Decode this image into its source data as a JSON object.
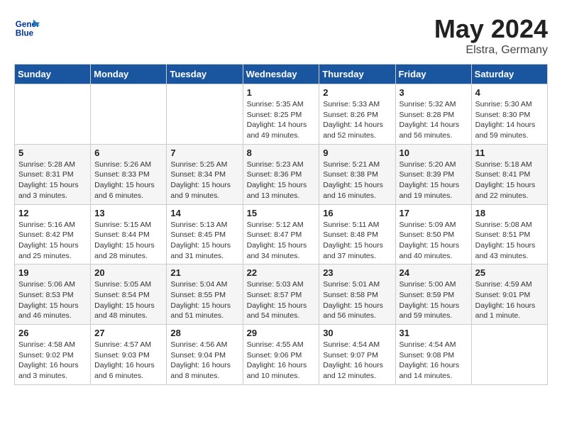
{
  "header": {
    "logo_line1": "General",
    "logo_line2": "Blue",
    "month": "May 2024",
    "location": "Elstra, Germany"
  },
  "weekdays": [
    "Sunday",
    "Monday",
    "Tuesday",
    "Wednesday",
    "Thursday",
    "Friday",
    "Saturday"
  ],
  "weeks": [
    [
      {
        "day": "",
        "info": ""
      },
      {
        "day": "",
        "info": ""
      },
      {
        "day": "",
        "info": ""
      },
      {
        "day": "1",
        "info": "Sunrise: 5:35 AM\nSunset: 8:25 PM\nDaylight: 14 hours\nand 49 minutes."
      },
      {
        "day": "2",
        "info": "Sunrise: 5:33 AM\nSunset: 8:26 PM\nDaylight: 14 hours\nand 52 minutes."
      },
      {
        "day": "3",
        "info": "Sunrise: 5:32 AM\nSunset: 8:28 PM\nDaylight: 14 hours\nand 56 minutes."
      },
      {
        "day": "4",
        "info": "Sunrise: 5:30 AM\nSunset: 8:30 PM\nDaylight: 14 hours\nand 59 minutes."
      }
    ],
    [
      {
        "day": "5",
        "info": "Sunrise: 5:28 AM\nSunset: 8:31 PM\nDaylight: 15 hours\nand 3 minutes."
      },
      {
        "day": "6",
        "info": "Sunrise: 5:26 AM\nSunset: 8:33 PM\nDaylight: 15 hours\nand 6 minutes."
      },
      {
        "day": "7",
        "info": "Sunrise: 5:25 AM\nSunset: 8:34 PM\nDaylight: 15 hours\nand 9 minutes."
      },
      {
        "day": "8",
        "info": "Sunrise: 5:23 AM\nSunset: 8:36 PM\nDaylight: 15 hours\nand 13 minutes."
      },
      {
        "day": "9",
        "info": "Sunrise: 5:21 AM\nSunset: 8:38 PM\nDaylight: 15 hours\nand 16 minutes."
      },
      {
        "day": "10",
        "info": "Sunrise: 5:20 AM\nSunset: 8:39 PM\nDaylight: 15 hours\nand 19 minutes."
      },
      {
        "day": "11",
        "info": "Sunrise: 5:18 AM\nSunset: 8:41 PM\nDaylight: 15 hours\nand 22 minutes."
      }
    ],
    [
      {
        "day": "12",
        "info": "Sunrise: 5:16 AM\nSunset: 8:42 PM\nDaylight: 15 hours\nand 25 minutes."
      },
      {
        "day": "13",
        "info": "Sunrise: 5:15 AM\nSunset: 8:44 PM\nDaylight: 15 hours\nand 28 minutes."
      },
      {
        "day": "14",
        "info": "Sunrise: 5:13 AM\nSunset: 8:45 PM\nDaylight: 15 hours\nand 31 minutes."
      },
      {
        "day": "15",
        "info": "Sunrise: 5:12 AM\nSunset: 8:47 PM\nDaylight: 15 hours\nand 34 minutes."
      },
      {
        "day": "16",
        "info": "Sunrise: 5:11 AM\nSunset: 8:48 PM\nDaylight: 15 hours\nand 37 minutes."
      },
      {
        "day": "17",
        "info": "Sunrise: 5:09 AM\nSunset: 8:50 PM\nDaylight: 15 hours\nand 40 minutes."
      },
      {
        "day": "18",
        "info": "Sunrise: 5:08 AM\nSunset: 8:51 PM\nDaylight: 15 hours\nand 43 minutes."
      }
    ],
    [
      {
        "day": "19",
        "info": "Sunrise: 5:06 AM\nSunset: 8:53 PM\nDaylight: 15 hours\nand 46 minutes."
      },
      {
        "day": "20",
        "info": "Sunrise: 5:05 AM\nSunset: 8:54 PM\nDaylight: 15 hours\nand 48 minutes."
      },
      {
        "day": "21",
        "info": "Sunrise: 5:04 AM\nSunset: 8:55 PM\nDaylight: 15 hours\nand 51 minutes."
      },
      {
        "day": "22",
        "info": "Sunrise: 5:03 AM\nSunset: 8:57 PM\nDaylight: 15 hours\nand 54 minutes."
      },
      {
        "day": "23",
        "info": "Sunrise: 5:01 AM\nSunset: 8:58 PM\nDaylight: 15 hours\nand 56 minutes."
      },
      {
        "day": "24",
        "info": "Sunrise: 5:00 AM\nSunset: 8:59 PM\nDaylight: 15 hours\nand 59 minutes."
      },
      {
        "day": "25",
        "info": "Sunrise: 4:59 AM\nSunset: 9:01 PM\nDaylight: 16 hours\nand 1 minute."
      }
    ],
    [
      {
        "day": "26",
        "info": "Sunrise: 4:58 AM\nSunset: 9:02 PM\nDaylight: 16 hours\nand 3 minutes."
      },
      {
        "day": "27",
        "info": "Sunrise: 4:57 AM\nSunset: 9:03 PM\nDaylight: 16 hours\nand 6 minutes."
      },
      {
        "day": "28",
        "info": "Sunrise: 4:56 AM\nSunset: 9:04 PM\nDaylight: 16 hours\nand 8 minutes."
      },
      {
        "day": "29",
        "info": "Sunrise: 4:55 AM\nSunset: 9:06 PM\nDaylight: 16 hours\nand 10 minutes."
      },
      {
        "day": "30",
        "info": "Sunrise: 4:54 AM\nSunset: 9:07 PM\nDaylight: 16 hours\nand 12 minutes."
      },
      {
        "day": "31",
        "info": "Sunrise: 4:54 AM\nSunset: 9:08 PM\nDaylight: 16 hours\nand 14 minutes."
      },
      {
        "day": "",
        "info": ""
      }
    ]
  ]
}
